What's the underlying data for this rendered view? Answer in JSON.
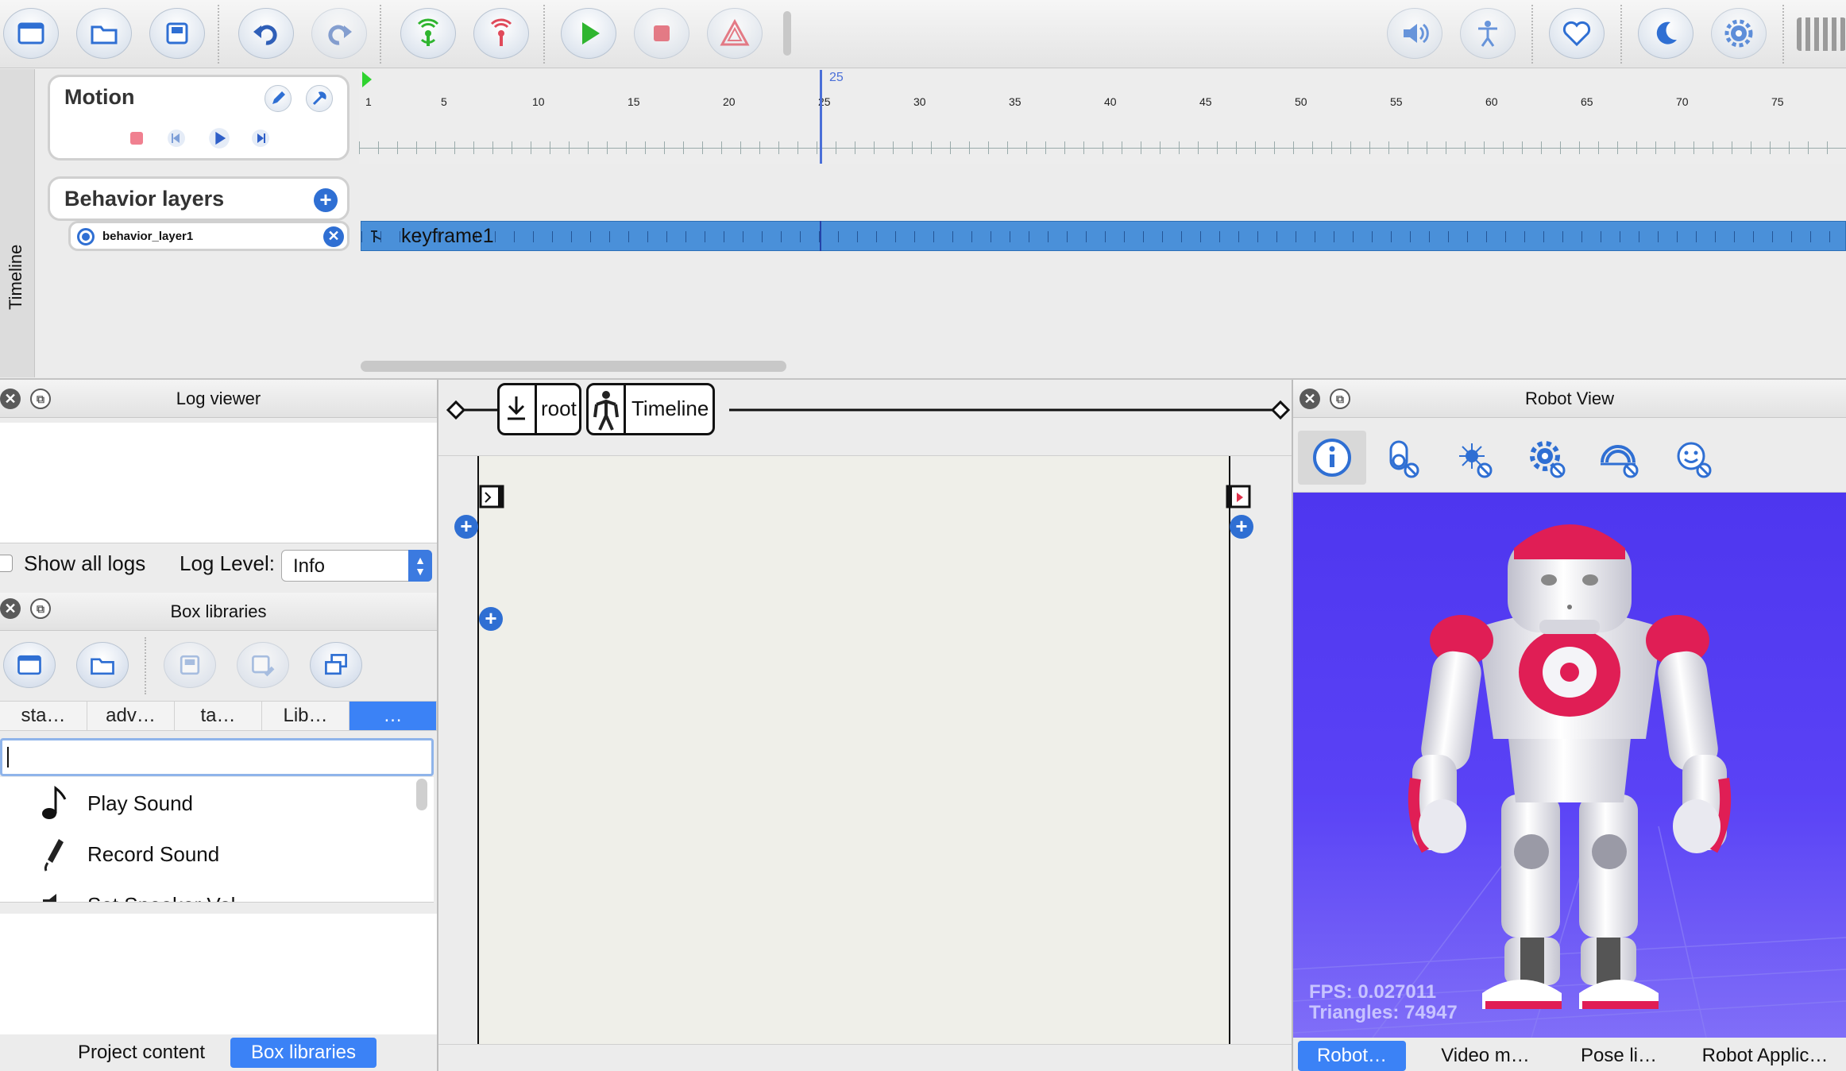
{
  "toolbar": {
    "icons": [
      "new-icon",
      "open-icon",
      "save-icon",
      "undo-icon",
      "redo-icon",
      "connect-icon",
      "disconnect-icon",
      "play-icon",
      "stop-icon",
      "warning-icon",
      "volume-icon",
      "posture-icon",
      "heart-icon",
      "sleep-icon",
      "settings-icon",
      "battery-icon"
    ],
    "colors": {
      "accent": "#2f6fd3",
      "green": "#2fb52f",
      "red": "#e04a5a"
    }
  },
  "timeline": {
    "side_label": "Timeline",
    "motion_title": "Motion",
    "behavior_layers_title": "Behavior layers",
    "layer_name": "behavior_layer1",
    "keyframe_label": "keyframe1",
    "playhead_frame": "25",
    "ticks": [
      "1",
      "5",
      "10",
      "15",
      "20",
      "25",
      "30",
      "35",
      "40",
      "45",
      "50",
      "55",
      "60",
      "65",
      "70",
      "75"
    ]
  },
  "log_viewer": {
    "title": "Log viewer",
    "show_all_logs": "Show all logs",
    "log_level_label": "Log Level:",
    "log_level_value": "Info"
  },
  "box_libraries": {
    "title": "Box libraries",
    "tabs": [
      "sta…",
      "adv…",
      "ta…",
      "Lib…",
      "…"
    ],
    "items": [
      "Play Sound",
      "Record Sound",
      "Set Speaker Vol."
    ]
  },
  "bottom_tabs_left": [
    "Project content",
    "Box libraries"
  ],
  "flow": {
    "breadcrumbs": [
      "root",
      "Timeline"
    ]
  },
  "robot_view": {
    "title": "Robot View",
    "fps": "FPS: 0.027011",
    "triangles": "Triangles: 74947",
    "tabs": [
      "Robot…",
      "Video m…",
      "Pose li…",
      "Robot Applic…"
    ],
    "background": "#5b43f6"
  }
}
